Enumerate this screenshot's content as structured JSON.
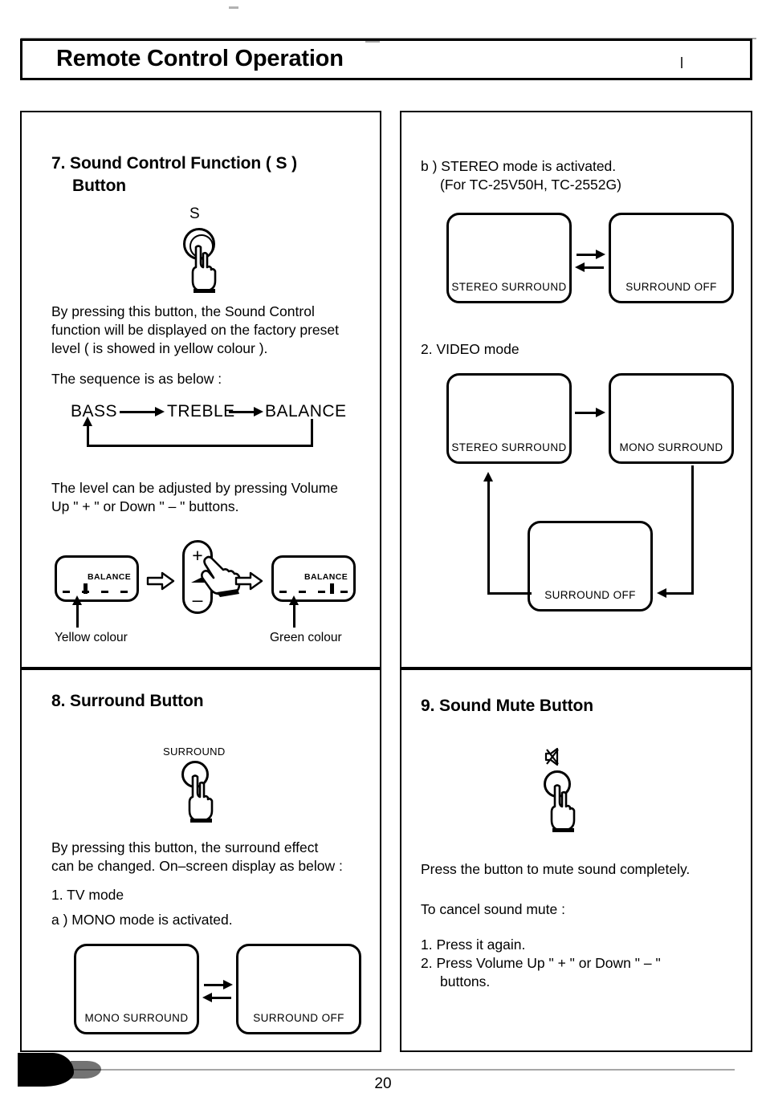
{
  "page": {
    "header_title": "Remote Control Operation",
    "page_number": "20"
  },
  "section_sound_control": {
    "heading_line1": "7. Sound Control Function ( S )",
    "heading_line2": "Button",
    "button_icon_label": "S",
    "paragraph1_line1": "By pressing this button, the Sound Control",
    "paragraph1_line2": "function will be displayed on the factory preset",
    "paragraph1_line3": "level ( is showed in yellow colour ).",
    "paragraph2": "The sequence is as below :",
    "sequence": [
      "BASS",
      "TREBLE",
      "BALANCE"
    ],
    "paragraph3_line1": "The level can be adjusted by pressing Volume",
    "paragraph3_line2": "Up \" + \" or Down \" – \" buttons.",
    "osd_before_label": "BALANCE",
    "osd_after_label": "BALANCE",
    "caption_before": "Yellow colour",
    "caption_after": "Green colour",
    "remote_plus": "+",
    "remote_minus": "–"
  },
  "section_stereo_mode": {
    "line1": "b ) STEREO mode is activated.",
    "line2": "(For TC-25V50H, TC-2552G)",
    "diagram": {
      "left_box": "STEREO SURROUND",
      "right_box": "SURROUND OFF"
    },
    "video_heading": "2. VIDEO mode",
    "video_diagram": {
      "box_top_left": "STEREO SURROUND",
      "box_top_right": "MONO SURROUND",
      "box_bottom": "SURROUND OFF"
    }
  },
  "section_surround": {
    "heading": "8. Surround Button",
    "button_icon_label": "SURROUND",
    "paragraph_line1": "By pressing this button, the surround effect",
    "paragraph_line2": "can be changed. On–screen display as below :",
    "mode_tv": "1. TV mode",
    "mode_tv_a": "a ) MONO mode is activated.",
    "diagram": {
      "left_box": "MONO SURROUND",
      "right_box": "SURROUND OFF"
    }
  },
  "section_mute": {
    "heading": "9. Sound Mute Button",
    "button_icon_name": "mute-speaker-icon",
    "paragraph1": "Press the button to mute sound completely.",
    "paragraph2": "To cancel sound mute :",
    "item1": "1. Press it again.",
    "item2_line1": "2. Press Volume Up \" + \" or Down \" – \"",
    "item2_line2": "buttons."
  }
}
